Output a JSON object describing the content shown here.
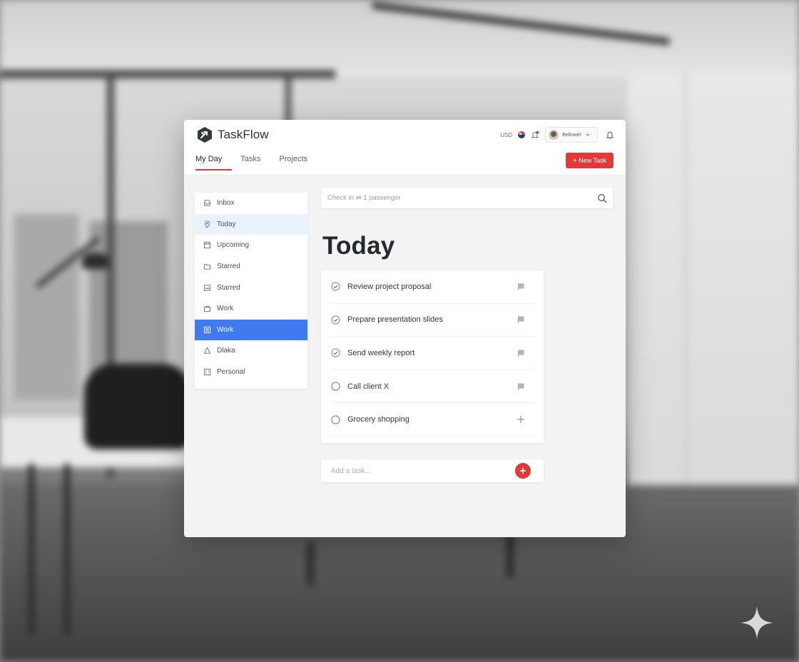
{
  "app": {
    "name": "TaskFlow",
    "accent_color": "#e0393a",
    "selected_color": "#3f7bef"
  },
  "header": {
    "currency": "USD",
    "profile_name": "Bellower",
    "new_task_label": "+ New Task"
  },
  "tabs": [
    {
      "label": "My Day",
      "active": true
    },
    {
      "label": "Tasks",
      "active": false
    },
    {
      "label": "Projects",
      "active": false
    }
  ],
  "sidebar": {
    "items": [
      {
        "label": "Inbox",
        "icon": "inbox-icon",
        "state": "normal"
      },
      {
        "label": "Today",
        "icon": "location-pin-icon",
        "state": "highlighted"
      },
      {
        "label": "Upcoming",
        "icon": "calendar-icon",
        "state": "normal"
      },
      {
        "label": "Starred",
        "icon": "folder-icon",
        "state": "normal"
      },
      {
        "label": "Starred",
        "icon": "image-icon",
        "state": "normal"
      },
      {
        "label": "Work",
        "icon": "bag-icon",
        "state": "normal"
      },
      {
        "label": "Work",
        "icon": "list-icon",
        "state": "selected"
      },
      {
        "label": "Dlaka",
        "icon": "triangle-icon",
        "state": "normal"
      },
      {
        "label": "Personal",
        "icon": "grid-icon",
        "state": "normal"
      }
    ]
  },
  "search": {
    "placeholder": "Check in ⇌ 1 passenger"
  },
  "main": {
    "title": "Today"
  },
  "tasks": [
    {
      "title": "Review project proposal",
      "done": true,
      "action_icon": "flag-icon"
    },
    {
      "title": "Prepare presentation slides",
      "done": true,
      "action_icon": "flag-icon"
    },
    {
      "title": "Send weekly report",
      "done": true,
      "action_icon": "flag-icon"
    },
    {
      "title": "Call client X",
      "done": false,
      "action_icon": "flag-icon"
    },
    {
      "title": "Grocery shopping",
      "done": false,
      "action_icon": "plus-icon"
    }
  ],
  "add_task": {
    "placeholder": "Add a task..."
  }
}
